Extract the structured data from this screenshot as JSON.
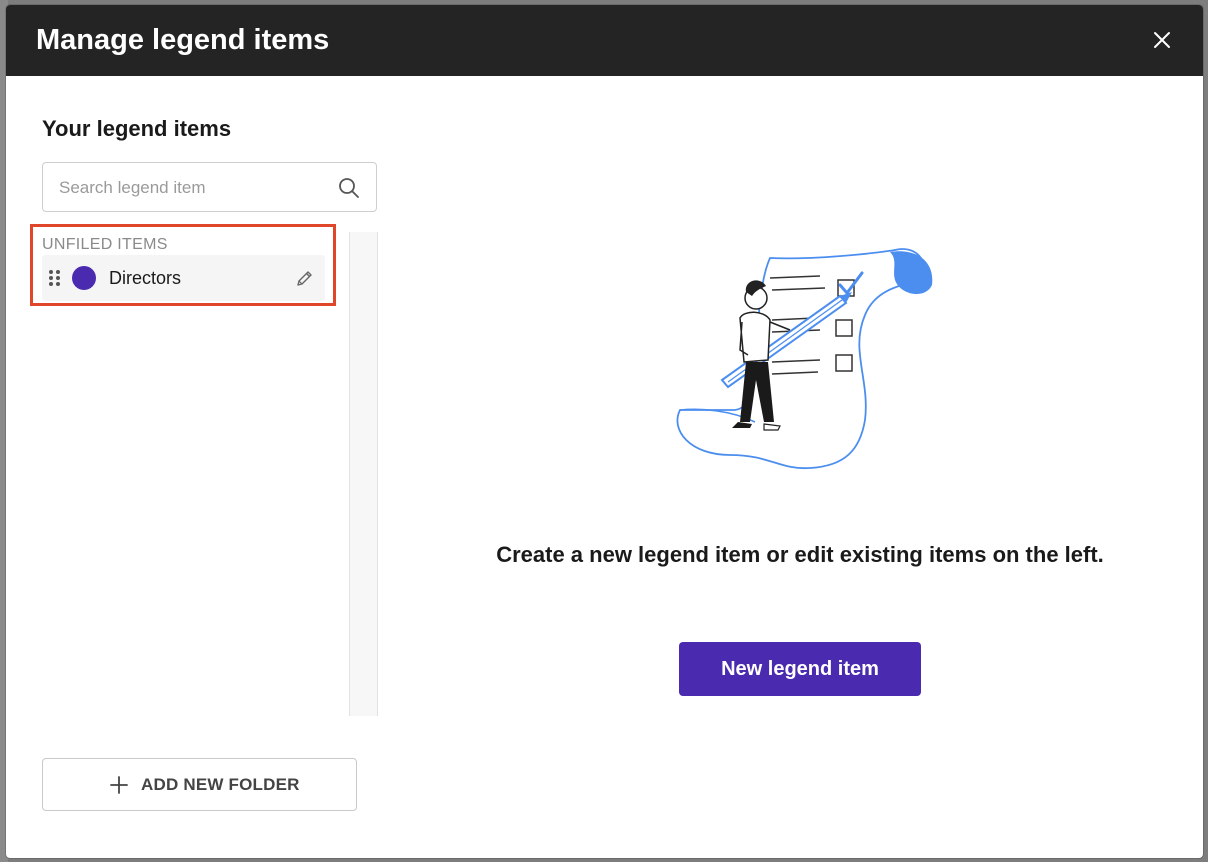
{
  "dialog": {
    "title": "Manage legend items",
    "close_icon": "close-icon"
  },
  "sidebar": {
    "title": "Your legend items",
    "search": {
      "placeholder": "Search legend item",
      "value": "",
      "icon": "search-icon"
    },
    "groups": [
      {
        "label": "UNFILED ITEMS",
        "items": [
          {
            "label": "Directors",
            "color": "#4a2bb0",
            "drag_icon": "drag-handle-icon",
            "edit_icon": "pencil-icon"
          }
        ]
      }
    ],
    "add_folder": {
      "label": "ADD NEW FOLDER",
      "icon": "plus-icon"
    }
  },
  "main": {
    "illustration": "person-with-checklist-illustration",
    "empty_message": "Create a new legend item or edit existing items on the left.",
    "new_item_label": "New legend item"
  },
  "colors": {
    "header_bg": "#242424",
    "primary": "#4a2bb0",
    "highlight": "#e0472a",
    "illustration_blue": "#4b8ef0"
  }
}
